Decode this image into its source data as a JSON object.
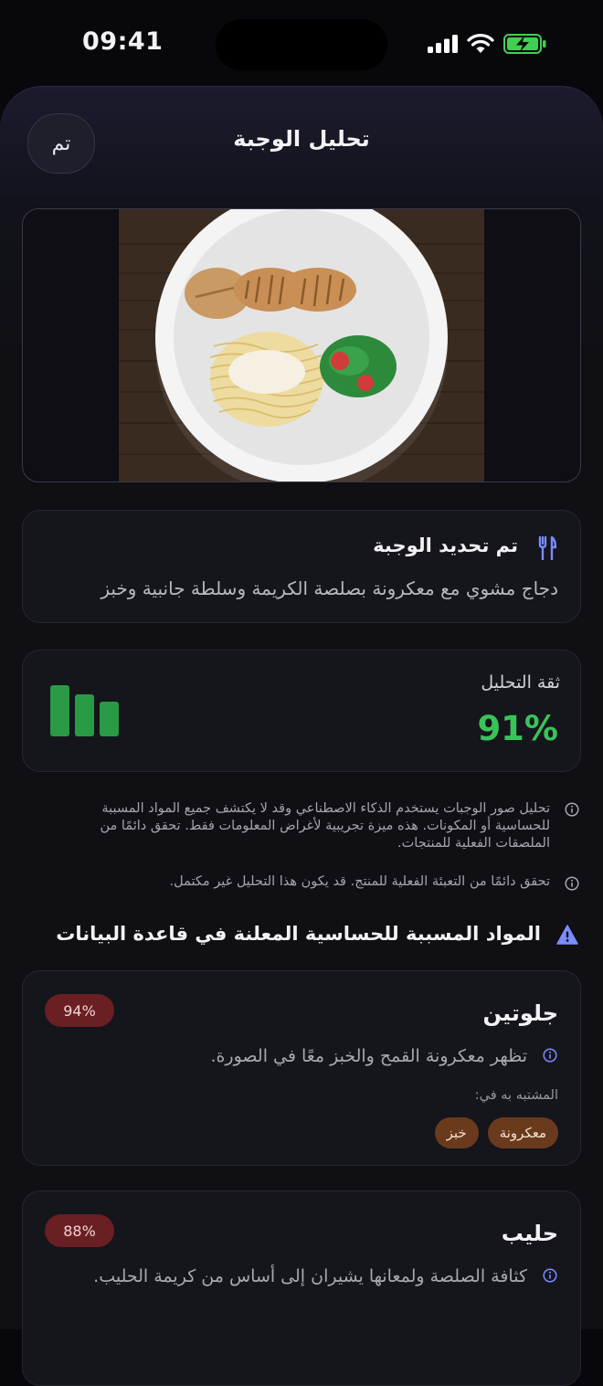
{
  "status": {
    "time": "09:41"
  },
  "header": {
    "title": "تحليل الوجبة",
    "done_label": "تم"
  },
  "meal": {
    "heading": "تم تحديد الوجبة",
    "description": "دجاج مشوي مع معكرونة بصلصة الكريمة وسلطة جانبية وخبز"
  },
  "confidence": {
    "label": "ثقة التحليل",
    "value": "91%",
    "color": "#38c458"
  },
  "notes": [
    "تحليل صور الوجبات يستخدم الذكاء الاصطناعي وقد لا يكتشف جميع المواد المسببة للحساسية أو المكونات. هذه ميزة تجريبية لأغراض المعلومات فقط. تحقق دائمًا من الملصقات الفعلية للمنتجات.",
    "تحقق دائمًا من التعبئة الفعلية للمنتج. قد يكون هذا التحليل غير مكتمل."
  ],
  "allergens_section": {
    "title": "المواد المسببة للحساسية المعلنة في قاعدة البيانات",
    "items": [
      {
        "name": "جلوتين",
        "percent": "94%",
        "reason": "تظهر معكرونة القمح والخبز معًا في الصورة.",
        "suspected_label": "المشتبه به في:",
        "suspected_in": [
          "معكرونة",
          "خبز"
        ]
      },
      {
        "name": "حليب",
        "percent": "88%",
        "reason": "كثافة الصلصة ولمعانها يشيران إلى أساس من كريمة الحليب."
      }
    ]
  },
  "icons": {
    "fork": "fork-knife-icon",
    "info": "info-circle-icon",
    "warning": "warning-triangle-icon",
    "confidence": "bar-chart-icon"
  },
  "colors": {
    "accent": "#7b8cff",
    "success": "#38c458",
    "badge": "#6a1f22",
    "chip": "#6a3a1c"
  }
}
